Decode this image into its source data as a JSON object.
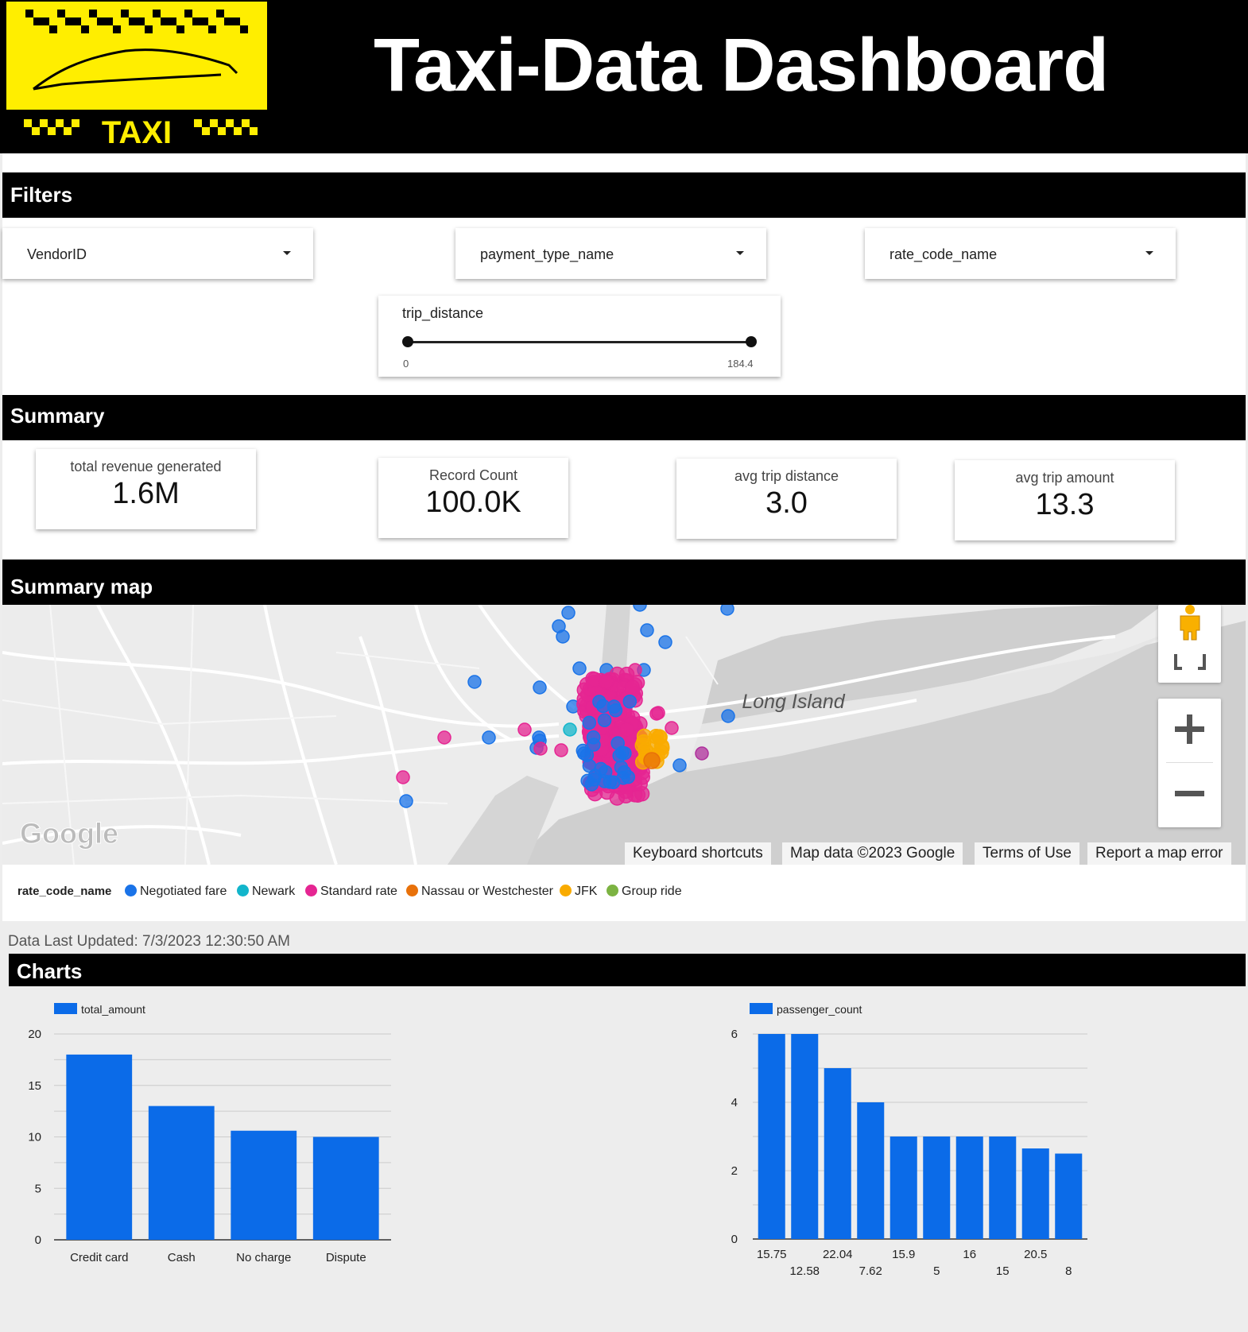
{
  "header": {
    "title": "Taxi-Data Dashboard",
    "logo_text": "TAXI",
    "logo_bg": "#ffee00"
  },
  "sections": {
    "filters": "Filters",
    "summary": "Summary",
    "summary_map": "Summary map",
    "charts": "Charts"
  },
  "filters": {
    "vendor": "VendorID",
    "payment_type": "payment_type_name",
    "rate_code": "rate_code_name",
    "trip_distance": {
      "label": "trip_distance",
      "min": "0",
      "max": "184.4"
    }
  },
  "summary": [
    {
      "label": "total revenue generated",
      "value": "1.6M"
    },
    {
      "label": "Record Count",
      "value": "100.0K"
    },
    {
      "label": "avg trip distance",
      "value": "3.0"
    },
    {
      "label": "avg trip amount",
      "value": "13.3"
    }
  ],
  "map": {
    "place_label": "Long Island",
    "google_logo": "Google",
    "footer": [
      "Keyboard shortcuts",
      "Map data ©2023 Google",
      "Terms of Use",
      "Report a map error"
    ],
    "legend_title": "rate_code_name",
    "legend": [
      {
        "name": "Negotiated fare",
        "color": "#1a73e8"
      },
      {
        "name": "Newark",
        "color": "#12b5cb"
      },
      {
        "name": "Standard rate",
        "color": "#e52592"
      },
      {
        "name": "Nassau or Westchester",
        "color": "#e8710a"
      },
      {
        "name": "JFK",
        "color": "#f9ab00"
      },
      {
        "name": "Group ride",
        "color": "#7cb342"
      }
    ]
  },
  "last_updated": "Data Last Updated: 7/3/2023 12:30:50 AM",
  "chart_data": [
    {
      "type": "bar",
      "series": [
        {
          "name": "total_amount",
          "values": [
            18,
            13,
            10.6,
            10
          ]
        }
      ],
      "categories": [
        "Credit card",
        "Cash",
        "No charge",
        "Dispute"
      ],
      "yticks": [
        0,
        5,
        10,
        15,
        20
      ],
      "ylim": [
        0,
        20
      ],
      "color": "#0b6be8"
    },
    {
      "type": "bar",
      "series": [
        {
          "name": "passenger_count",
          "values": [
            6,
            6,
            5,
            4,
            3,
            3,
            3,
            3,
            2.65,
            2.5
          ]
        }
      ],
      "categories": [
        "15.75",
        "12.58",
        "22.04",
        "7.62",
        "15.9",
        "5",
        "16",
        "15",
        "20.5",
        "8"
      ],
      "yticks": [
        0,
        2,
        4,
        6
      ],
      "ylim": [
        0,
        6
      ],
      "color": "#0b6be8"
    }
  ]
}
